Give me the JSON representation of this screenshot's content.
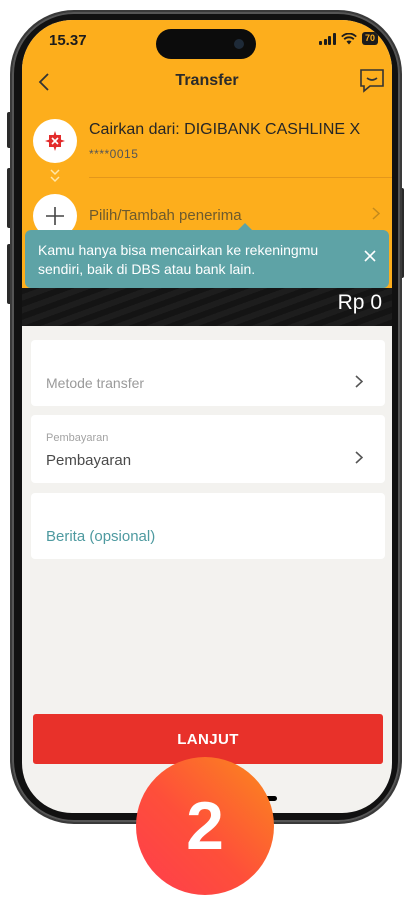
{
  "status": {
    "time": "15.37",
    "battery": "70"
  },
  "nav": {
    "title": "Transfer"
  },
  "source": {
    "title": "Cairkan dari: DIGIBANK CASHLINE X",
    "account": "****0015"
  },
  "recipient": {
    "label": "Pilih/Tambah penerima"
  },
  "tooltip": {
    "text": "Kamu hanya bisa mencairkan ke rekeningmu sendiri, baik di DBS atau bank lain."
  },
  "amount": {
    "value": "Rp 0"
  },
  "form": {
    "method_placeholder": "Metode transfer",
    "payment_label": "Pembayaran",
    "payment_value": "Pembayaran",
    "message_placeholder": "Berita (opsional)"
  },
  "actions": {
    "next_label": "LANJUT"
  },
  "badge": {
    "step": "2"
  },
  "colors": {
    "header": "#fdae1c",
    "tooltip": "#5ea3a6",
    "button": "#e8312a",
    "brand_red": "#e32b2b"
  }
}
